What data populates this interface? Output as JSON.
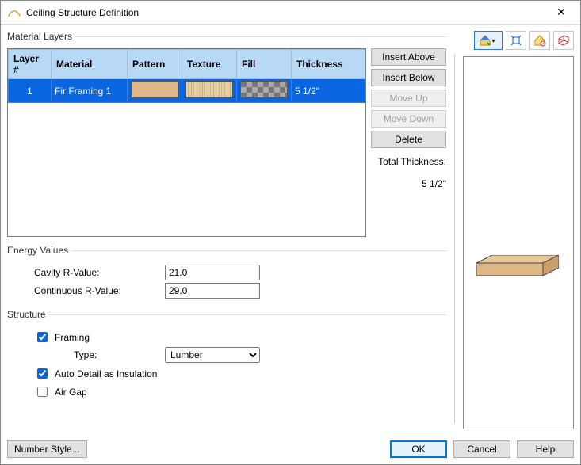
{
  "window": {
    "title": "Ceiling Structure Definition"
  },
  "material_layers": {
    "legend": "Material Layers",
    "columns": {
      "layer_no": "Layer #",
      "material": "Material",
      "pattern": "Pattern",
      "texture": "Texture",
      "fill": "Fill",
      "thickness": "Thickness"
    },
    "rows": [
      {
        "layer_no": "1",
        "material": "Fir Framing 1",
        "thickness": "5 1/2\""
      }
    ],
    "buttons": {
      "insert_above": "Insert Above",
      "insert_below": "Insert Below",
      "move_up": "Move Up",
      "move_down": "Move Down",
      "delete": "Delete"
    },
    "total_label": "Total Thickness:",
    "total_value": "5 1/2\""
  },
  "energy": {
    "legend": "Energy Values",
    "cavity_label": "Cavity R-Value:",
    "cavity_value": "21.0",
    "continuous_label": "Continuous R-Value:",
    "continuous_value": "29.0"
  },
  "structure": {
    "legend": "Structure",
    "framing_label": "Framing",
    "framing_checked": true,
    "type_label": "Type:",
    "type_value": "Lumber",
    "auto_detail_label": "Auto Detail as Insulation",
    "auto_detail_checked": true,
    "air_gap_label": "Air Gap",
    "air_gap_checked": false
  },
  "footer": {
    "number_style": "Number Style...",
    "ok": "OK",
    "cancel": "Cancel",
    "help": "Help"
  },
  "toolbar_icons": {
    "house_color": "house-color-icon",
    "expand": "expand-icon",
    "house_line": "house-final-icon",
    "perspective": "perspective-icon"
  }
}
